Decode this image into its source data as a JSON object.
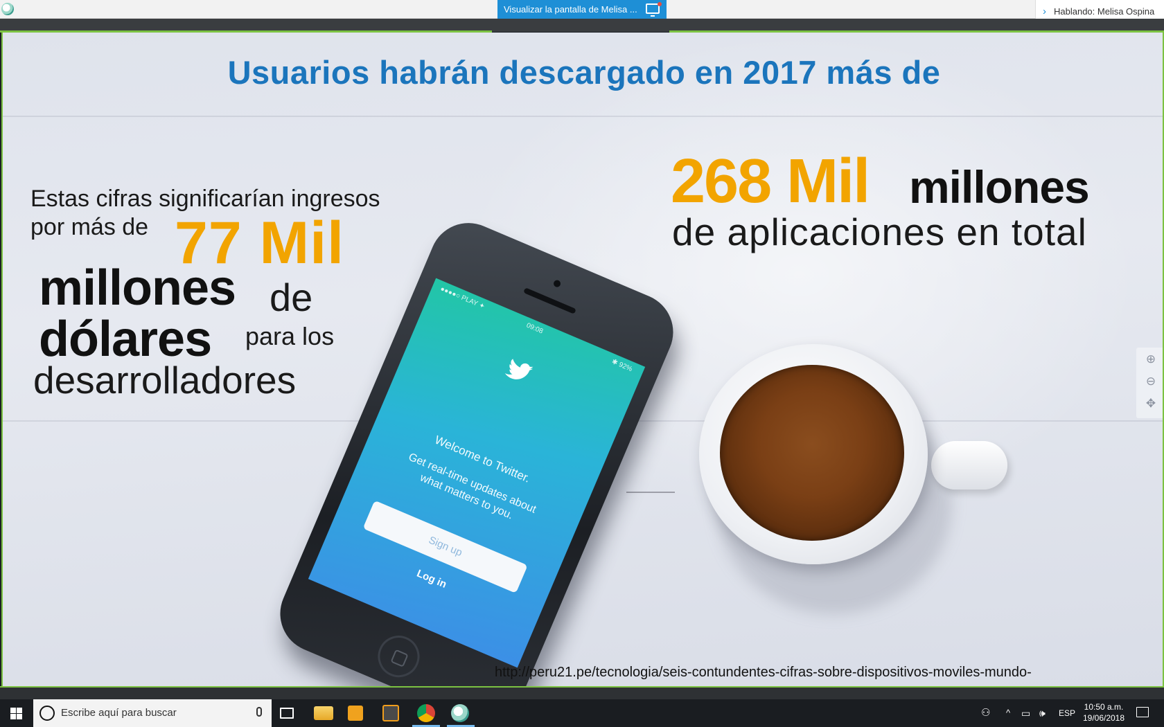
{
  "window": {
    "share_tab_label": "Visualizar la pantalla de Melisa ...",
    "speaking_label": "Hablando: Melisa Ospina"
  },
  "slide": {
    "title": "Usuarios habrán descargado en 2017 más de",
    "left": {
      "line1": "Estas cifras significarían ingresos",
      "line2": "por más de",
      "big_number": "77 Mil",
      "millones": "millones",
      "de": "de",
      "dolares": "dólares",
      "para_los": "para los",
      "desarrolladores": "desarrolladores"
    },
    "right": {
      "big_number": "268 Mil",
      "millones": "millones",
      "line2": "de aplicaciones en total"
    },
    "source_url": "http://peru21.pe/tecnologia/seis-contundentes-cifras-sobre-dispositivos-moviles-mundo-",
    "phone_screen": {
      "carrier": "●●●●○ PLAY ✦",
      "time": "09:08",
      "battery": "✱ 92%",
      "welcome": "Welcome to Twitter.",
      "subtitle_line1": "Get real-time updates about",
      "subtitle_line2": "what matters to you.",
      "signup": "Sign up",
      "login": "Log in"
    }
  },
  "taskbar": {
    "search_placeholder": "Escribe aquí para buscar",
    "language": "ESP",
    "time": "10:50 a.m.",
    "date": "19/06/2018"
  },
  "colors": {
    "title_blue": "#1b75bc",
    "accent_orange": "#f2a400",
    "share_blue": "#1e8fd6",
    "frame_green": "#7cc242"
  },
  "icons": [
    "app-badge-icon",
    "screen-share-icon",
    "chevron-right-icon",
    "zoom-in-icon",
    "zoom-out-icon",
    "move-icon",
    "windows-start-icon",
    "cortana-icon",
    "microphone-icon",
    "task-view-icon",
    "file-explorer-icon",
    "media-player-icon",
    "sublime-icon",
    "chrome-icon",
    "meeting-app-icon",
    "people-icon",
    "chevron-up-icon",
    "network-icon",
    "volume-icon",
    "notification-icon"
  ]
}
